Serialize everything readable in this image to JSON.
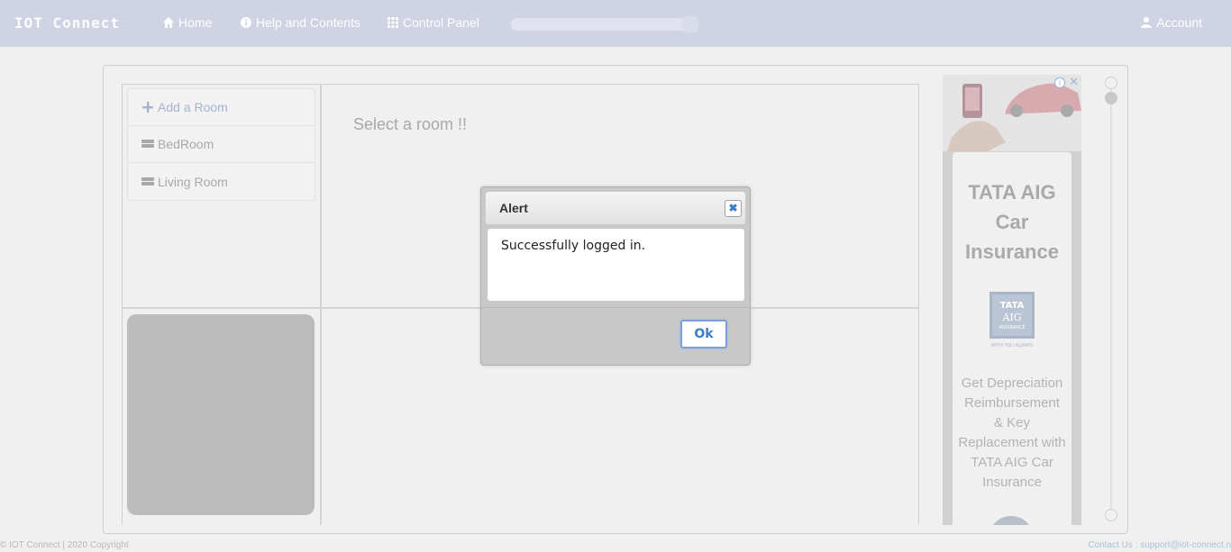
{
  "navbar": {
    "brand": "IOT Connect",
    "home": "Home",
    "help": "Help and Contents",
    "control_panel": "Control Panel",
    "account": "Account",
    "progress_fraction": 1.0
  },
  "rooms": {
    "add_label": "Add a Room",
    "items": [
      {
        "label": "BedRoom"
      },
      {
        "label": "Living Room"
      }
    ]
  },
  "main": {
    "select_prompt": "Select a room !!"
  },
  "ad": {
    "title": "TATA AIG Car Insurance",
    "logo_text_1": "TATA",
    "logo_text_2": "AIG",
    "logo_text_3": "INSURANCE",
    "tagline": "WITH YOU ALWAYS",
    "description": "Get Depreciation Reimbursement & Key Replacement with TATA AIG Car Insurance",
    "info_glyph": "i",
    "close_glyph": "✕"
  },
  "footer": {
    "copyright": "© IOT Connect | 2020 Copyright",
    "contact": "Contact Us : support@iot-connect.n"
  },
  "dialog": {
    "title": "Alert",
    "message": "Successfully logged in.",
    "ok_label": "Ok",
    "close_glyph": "✖"
  },
  "colors": {
    "navbar_bg": "#cfd3e3",
    "page_bg": "#f0f0f0",
    "accent": "#3b7dc4",
    "ad_link": "#9bb6d6"
  }
}
